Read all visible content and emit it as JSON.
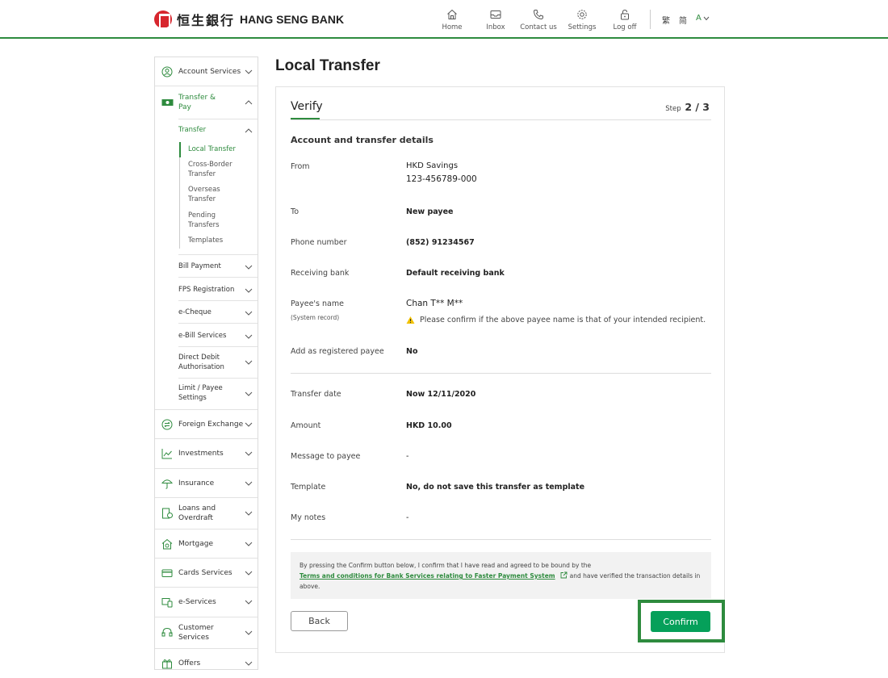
{
  "header": {
    "logo_cn": "恒生銀行",
    "logo_en": "HANG SENG BANK",
    "nav": [
      {
        "label": "Home",
        "icon": "home-icon"
      },
      {
        "label": "Inbox",
        "icon": "inbox-icon"
      },
      {
        "label": "Contact us",
        "icon": "phone-icon"
      },
      {
        "label": "Settings",
        "icon": "gear-icon"
      },
      {
        "label": "Log off",
        "icon": "lock-icon"
      }
    ],
    "lang_trad": "繁",
    "lang_simp": "简",
    "font_size": "A"
  },
  "sidebar": {
    "account_services": "Account Services",
    "transfer_pay_1": "Transfer &",
    "transfer_pay_2": "Pay",
    "transfer": "Transfer",
    "local_transfer": "Local Transfer",
    "cross_border_1": "Cross-Border",
    "cross_border_2": "Transfer",
    "overseas_1": "Overseas",
    "overseas_2": "Transfer",
    "pending_1": "Pending",
    "pending_2": "Transfers",
    "templates": "Templates",
    "bill_payment": "Bill Payment",
    "fps_registration": "FPS Registration",
    "e_cheque": "e-Cheque",
    "e_bill": "e-Bill Services",
    "direct_debit_1": "Direct Debit",
    "direct_debit_2": "Authorisation",
    "limit_1": "Limit / Payee",
    "limit_2": "Settings",
    "foreign_exchange": "Foreign Exchange",
    "investments": "Investments",
    "insurance": "Insurance",
    "loans_1": "Loans and",
    "loans_2": "Overdraft",
    "mortgage": "Mortgage",
    "cards": "Cards Services",
    "e_services": "e-Services",
    "customer_1": "Customer",
    "customer_2": "Services",
    "offers": "Offers"
  },
  "main": {
    "page_title": "Local Transfer",
    "tab": "Verify",
    "step_prefix": "Step",
    "step_value": "2 / 3",
    "section_title": "Account and transfer details",
    "from_label": "From",
    "from_account_name": "HKD Savings",
    "from_account_no": "123-456789-000",
    "to_label": "To",
    "to_value": "New payee",
    "phone_label": "Phone number",
    "phone_value": "(852) 91234567",
    "bank_label": "Receiving bank",
    "bank_value": "Default receiving bank",
    "payee_label": "Payee's name",
    "payee_sublabel": "(System record)",
    "payee_value": "Chan T** M**",
    "payee_warning": "Please confirm if the above payee name is that of your intended recipient.",
    "add_payee_label": "Add as registered payee",
    "add_payee_value": "No",
    "date_label": "Transfer date",
    "date_value": "Now 12/11/2020",
    "amount_label": "Amount",
    "amount_value": "HKD 10.00",
    "message_label": "Message to payee",
    "message_value": "-",
    "template_label": "Template",
    "template_value": "No, do not save this transfer as template",
    "notes_label": "My notes",
    "notes_value": "-",
    "terms_prefix": "By pressing the Confirm button below, I confirm that I have read and agreed to be bound by the",
    "terms_link": "Terms and conditions for Bank Services relating to Faster Payment System",
    "terms_suffix": "and have verified the transaction details in above.",
    "back_button": "Back",
    "confirm_button": "Confirm"
  },
  "colors": {
    "brand_green": "#2e8b3e",
    "confirm_green": "#05a05a",
    "logo_red": "#d7262e",
    "warning_yellow": "#f2c200"
  }
}
